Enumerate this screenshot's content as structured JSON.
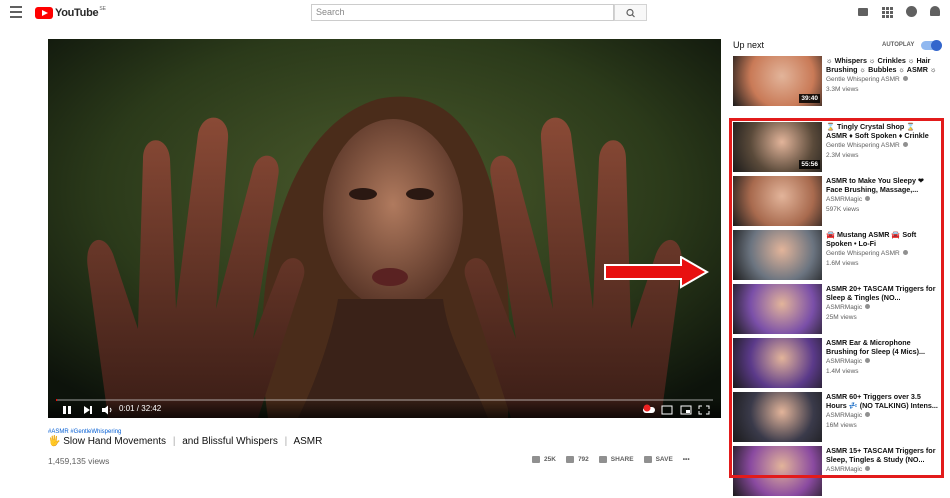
{
  "header": {
    "logo_text": "YouTube",
    "logo_region": "SE",
    "search_placeholder": "Search",
    "icons": [
      "menu-icon",
      "search-icon",
      "create-video-icon",
      "apps-grid-icon",
      "messages-icon",
      "notifications-bell-icon"
    ]
  },
  "player": {
    "current_time": "0:01 / 32:42",
    "progress": 0.0005,
    "icons": [
      "pause-icon",
      "next-icon",
      "volume-icon",
      "autoplay-toggle-icon",
      "subtitles-icon",
      "miniplayer-icon",
      "theater-mode-icon",
      "fullscreen-icon"
    ]
  },
  "video": {
    "hashtags": "#ASMR #GentleWhispering",
    "title_emoji": "🖐",
    "title_parts": [
      "Slow Hand Movements",
      "and Blissful Whispers",
      "ASMR"
    ],
    "title_separator": "|",
    "views": "1,459,135 views",
    "likes": "25K",
    "dislikes": "792",
    "share_label": "SHARE",
    "save_label": "SAVE",
    "more_label": "•••"
  },
  "sidebar": {
    "up_next_label": "Up next",
    "autoplay_label": "AUTOPLAY",
    "autoplay_on": true,
    "videos": [
      {
        "title": "☼ Whispers ☼ Crinkles ☼ Hair Brushing ☼ Bubbles ☼ ASMR ☼",
        "channel": "Gentle Whispering ASMR",
        "verified": true,
        "views": "3.3M views",
        "duration": "39:40",
        "thumb_color": "#c97a57"
      },
      {
        "title": "⌛ Tingly Crystal Shop ⌛ ASMR ♦ Soft Spoken ♦ Crinkle Shirt",
        "channel": "Gentle Whispering ASMR",
        "verified": true,
        "views": "2.3M views",
        "duration": "55:56",
        "thumb_color": "#5a4a3a"
      },
      {
        "title": "ASMR to Make You Sleepy ❤ Face Brushing, Massage,...",
        "channel": "ASMRMagic",
        "verified": true,
        "views": "597K views",
        "duration": "",
        "thumb_color": "#a86a4e"
      },
      {
        "title": "🚘 Mustang ASMR 🚘 Soft Spoken • Lo-Fi",
        "channel": "Gentle Whispering ASMR",
        "verified": true,
        "views": "1.6M views",
        "duration": "",
        "thumb_color": "#6b7480"
      },
      {
        "title": "ASMR 20+ TASCAM Triggers for Sleep & Tingles (NO...",
        "channel": "ASMRMagic",
        "verified": true,
        "views": "25M views",
        "duration": "",
        "thumb_color": "#7a4fa8"
      },
      {
        "title": "ASMR Ear & Microphone Brushing for Sleep (4 Mics)...",
        "channel": "ASMRMagic",
        "verified": true,
        "views": "1.4M views",
        "duration": "",
        "thumb_color": "#5b3a8a"
      },
      {
        "title": "ASMR 60+ Triggers over 3.5 Hours 💤 (NO TALKING) Intens...",
        "channel": "ASMRMagic",
        "verified": true,
        "views": "16M views",
        "duration": "",
        "thumb_color": "#3a3a4a"
      },
      {
        "title": "ASMR 15+ TASCAM Triggers for Sleep, Tingles & Study (NO...",
        "channel": "ASMRMagic",
        "verified": true,
        "views": "",
        "duration": "",
        "thumb_color": "#8a4aa0"
      }
    ]
  }
}
